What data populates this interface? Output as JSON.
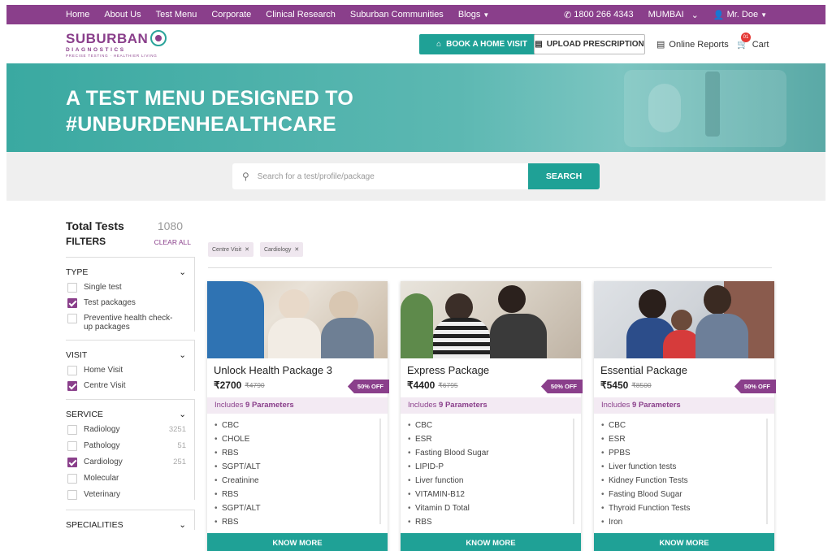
{
  "topnav": {
    "items": [
      "Home",
      "About Us",
      "Test Menu",
      "Corporate",
      "Clinical Research",
      "Suburban Communities",
      "Blogs"
    ],
    "phone": "1800 266 4343",
    "city": "MUMBAI",
    "user": "Mr. Doe"
  },
  "header": {
    "logo_line1": "SUBURBAN",
    "logo_line2": "DIAGNOSTICS",
    "logo_tagline": "PRECISE TESTING · HEALTHIER LIVING",
    "book_label": "BOOK A HOME VISIT",
    "upload_label": "UPLOAD PRESCRIPTION",
    "reports_label": "Online Reports",
    "cart_label": "Cart",
    "cart_count": "01"
  },
  "hero": {
    "line1": "A TEST MENU DESIGNED TO",
    "line2": "#UNBURDENHEALTHCARE"
  },
  "search": {
    "placeholder": "Search for a test/profile/package",
    "button": "SEARCH"
  },
  "sidebar": {
    "total_label": "Total Tests",
    "total_count": "1080",
    "filters_label": "FILTERS",
    "clear_label": "CLEAR ALL",
    "type": {
      "label": "TYPE",
      "options": [
        {
          "label": "Single test",
          "checked": false
        },
        {
          "label": "Test packages",
          "checked": true
        },
        {
          "label": "Preventive health check-up packages",
          "checked": false
        }
      ]
    },
    "visit": {
      "label": "VISIT",
      "options": [
        {
          "label": "Home Visit",
          "checked": false
        },
        {
          "label": "Centre Visit",
          "checked": true
        }
      ]
    },
    "service": {
      "label": "SERVICE",
      "options": [
        {
          "label": "Radiology",
          "count": "3251",
          "checked": false
        },
        {
          "label": "Pathology",
          "count": "51",
          "checked": false
        },
        {
          "label": "Cardiology",
          "count": "251",
          "checked": true
        },
        {
          "label": "Molecular",
          "count": "",
          "checked": false
        },
        {
          "label": "Veterinary",
          "count": "",
          "checked": false
        }
      ]
    },
    "specialities_label": "SPECIALITIES"
  },
  "chips": [
    "Centre Visit",
    "Cardiology"
  ],
  "cards": [
    {
      "title": "Unlock Health Package 3",
      "price": "₹2700",
      "old_price": "₹4790",
      "discount": "50% OFF",
      "includes_prefix": "Includes",
      "includes_count": "9 Parameters",
      "params": [
        "CBC",
        "CHOLE",
        "RBS",
        "SGPT/ALT",
        "Creatinine",
        "RBS",
        "SGPT/ALT",
        "RBS"
      ],
      "cta": "KNOW MORE"
    },
    {
      "title": "Express Package",
      "price": "₹4400",
      "old_price": "₹6795",
      "discount": "50% OFF",
      "includes_prefix": "Includes",
      "includes_count": "9 Parameters",
      "params": [
        "CBC",
        "ESR",
        "Fasting Blood Sugar",
        "LIPID-P",
        "Liver function",
        "VITAMIN-B12",
        "Vitamin D Total",
        "RBS"
      ],
      "cta": "KNOW MORE"
    },
    {
      "title": "Essential Package",
      "price": "₹5450",
      "old_price": "₹8500",
      "discount": "50% OFF",
      "includes_prefix": "Includes",
      "includes_count": "9 Parameters",
      "params": [
        "CBC",
        "ESR",
        "PPBS",
        "Liver function tests",
        "Kidney Function Tests",
        "Fasting Blood Sugar",
        "Thyroid Function Tests",
        "Iron"
      ],
      "cta": "KNOW MORE"
    }
  ],
  "colors": {
    "brand": "#8a3f8b",
    "accent": "#1fa196"
  }
}
